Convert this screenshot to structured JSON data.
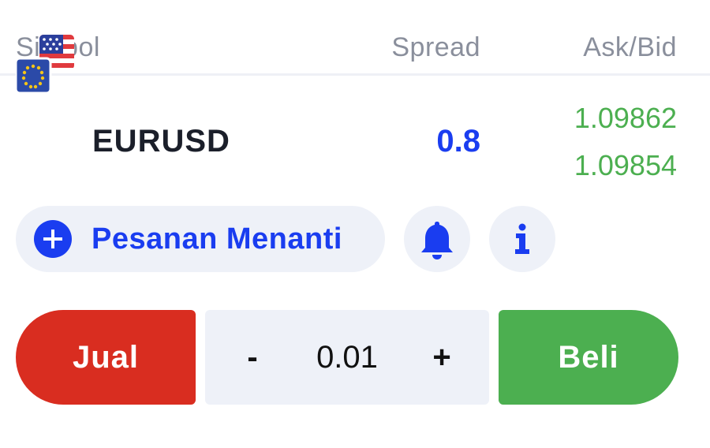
{
  "header": {
    "symbol_label": "Simbol",
    "spread_label": "Spread",
    "askbid_label": "Ask/Bid"
  },
  "instrument": {
    "symbol": "EURUSD",
    "spread": "0.8",
    "ask": "1.09862",
    "bid": "1.09854",
    "icons": [
      "us-flag-icon",
      "eu-flag-icon"
    ]
  },
  "actions": {
    "pending_order_label": "Pesanan Menanti",
    "pending_icon": "plus-circle-icon",
    "alert_icon": "bell-icon",
    "info_icon": "info-icon"
  },
  "trade": {
    "sell_label": "Jual",
    "buy_label": "Beli",
    "minus_label": "-",
    "plus_label": "+",
    "volume": "0.01"
  },
  "colors": {
    "accent_blue": "#1a3df0",
    "ask_bid_green": "#4caf50",
    "sell_red": "#d92d20",
    "buy_green": "#4caf50",
    "control_bg": "#eef1f8",
    "muted_text": "#8a8f9c"
  }
}
